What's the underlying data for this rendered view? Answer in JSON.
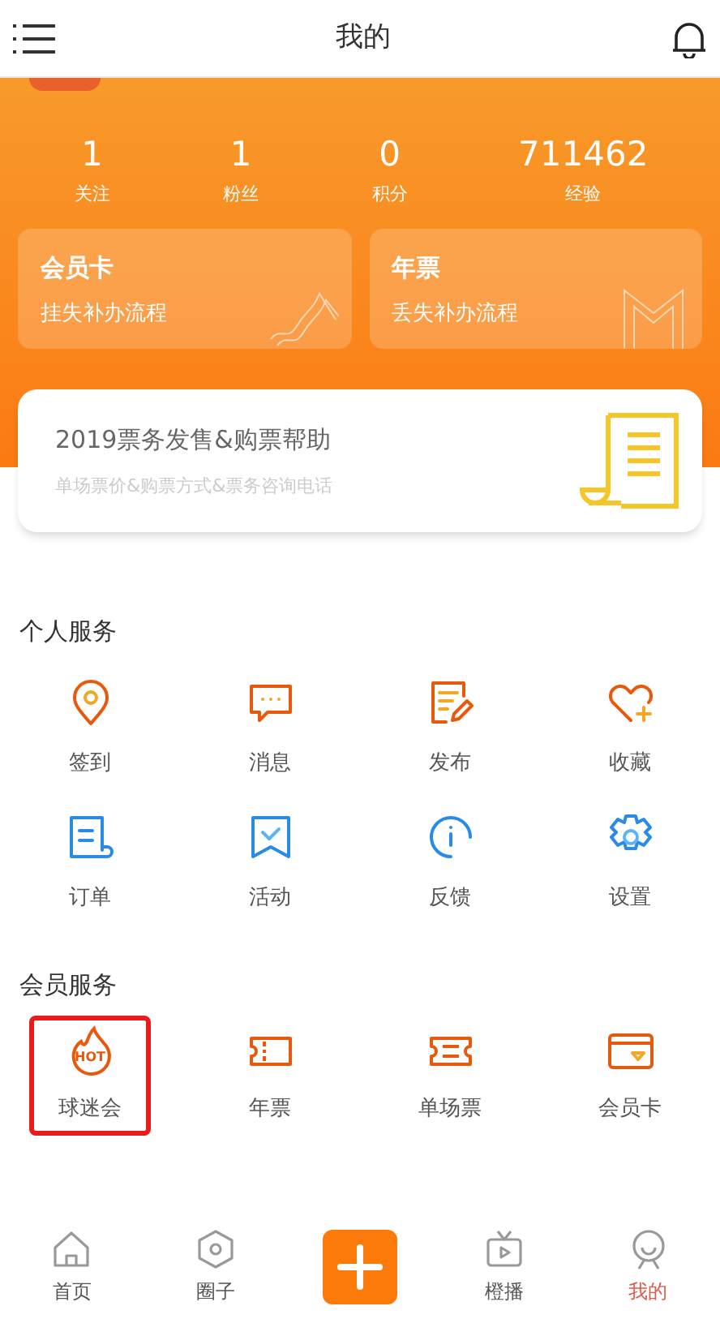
{
  "header": {
    "title": "我的"
  },
  "stats": [
    {
      "value": "1",
      "label": "关注"
    },
    {
      "value": "1",
      "label": "粉丝"
    },
    {
      "value": "0",
      "label": "积分"
    },
    {
      "value": "711462",
      "label": "经验"
    }
  ],
  "cards": [
    {
      "title": "会员卡",
      "subtitle": "挂失补办流程"
    },
    {
      "title": "年票",
      "subtitle": "丢失补办流程"
    }
  ],
  "help": {
    "title": "2019票务发售&购票帮助",
    "subtitle": "单场票价&购票方式&票务咨询电话"
  },
  "personal_services": {
    "title": "个人服务",
    "items": [
      {
        "label": "签到"
      },
      {
        "label": "消息"
      },
      {
        "label": "发布"
      },
      {
        "label": "收藏"
      },
      {
        "label": "订单"
      },
      {
        "label": "活动"
      },
      {
        "label": "反馈"
      },
      {
        "label": "设置"
      }
    ]
  },
  "member_services": {
    "title": "会员服务",
    "items": [
      {
        "label": "球迷会",
        "badge": "HOT",
        "highlighted": true
      },
      {
        "label": "年票",
        "highlighted": false
      },
      {
        "label": "单场票",
        "highlighted": false
      },
      {
        "label": "会员卡",
        "highlighted": false
      }
    ]
  },
  "tab_bar": [
    {
      "kind": "tab",
      "label": "首页",
      "selected": false
    },
    {
      "kind": "tab",
      "label": "圈子",
      "selected": false
    },
    {
      "kind": "plus"
    },
    {
      "kind": "tab",
      "label": "橙播",
      "selected": false
    },
    {
      "kind": "tab",
      "label": "我的",
      "selected": true
    }
  ]
}
